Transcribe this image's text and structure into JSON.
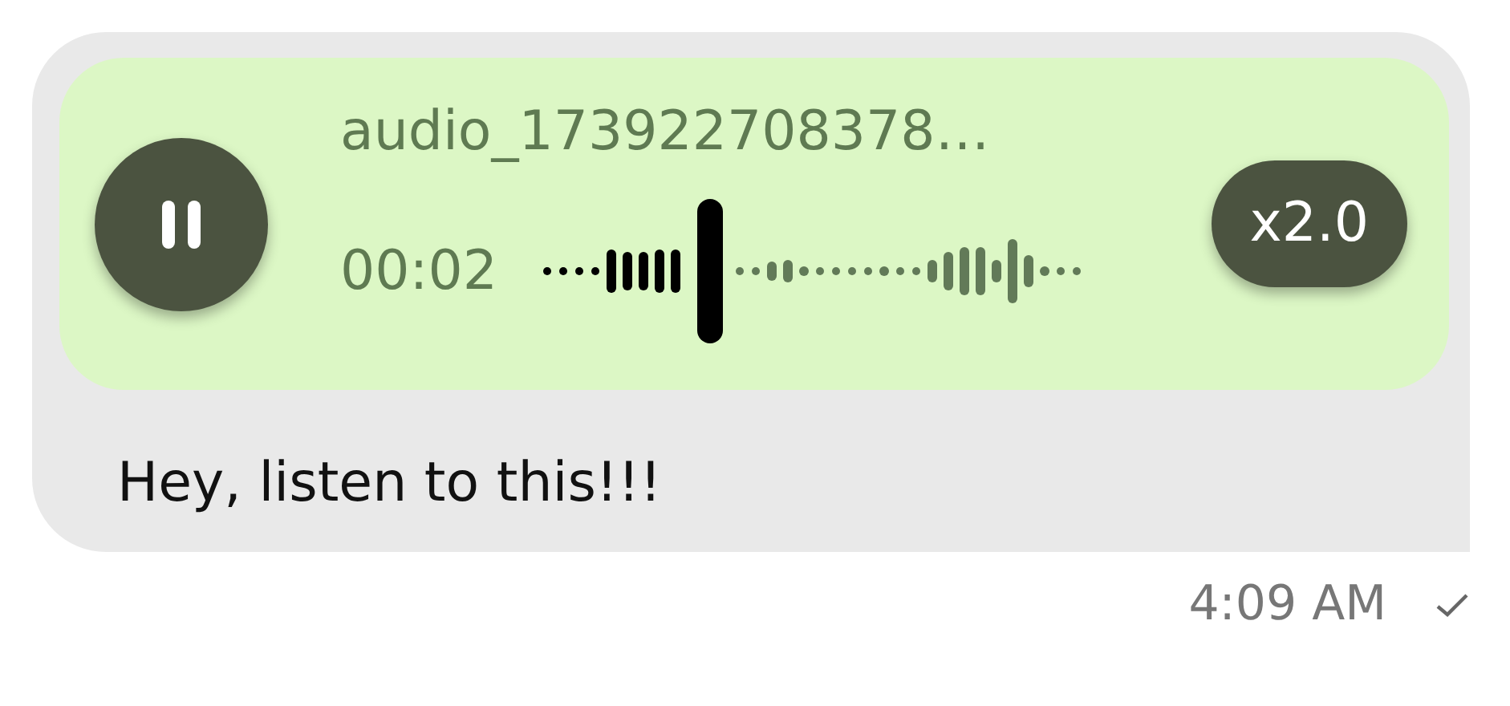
{
  "message": {
    "audio": {
      "title": "audio_173922708378…",
      "elapsed": "00:02",
      "playing": true,
      "level": 0.31,
      "speed": "x2.0"
    },
    "text": "Hey, listen to this!!!",
    "time": "4:09 AM",
    "delivered": true
  }
}
